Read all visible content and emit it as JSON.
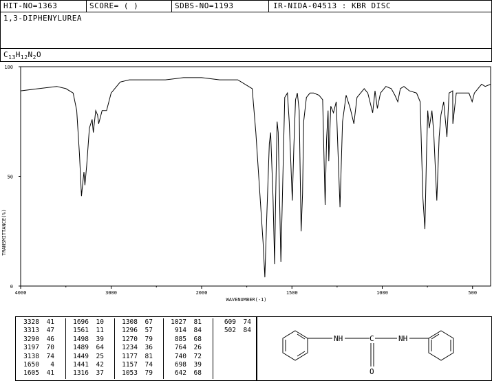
{
  "header": {
    "hit_no": "HIT-NO=1363",
    "score": "SCORE=  (   )",
    "sdbs_no": "SDBS-NO=1193",
    "ir_id": "IR-NIDA-04513 : KBR DISC",
    "compound": "1,3-DIPHENYLUREA",
    "formula": {
      "c": "C",
      "c_n": "13",
      "h": "H",
      "h_n": "12",
      "n": "N",
      "n_n": "2",
      "o": "O"
    }
  },
  "chart_data": {
    "type": "line",
    "title": "",
    "xlabel": "WAVENUMBER(-1)",
    "ylabel": "TRANSMITTANCE(%)",
    "xlim": [
      4000,
      400
    ],
    "ylim": [
      0,
      100
    ],
    "x_ticks": [
      "4000",
      "3000",
      "2000",
      "1500",
      "1000",
      "500"
    ],
    "y_ticks": [
      "100",
      "50",
      "0"
    ],
    "grid": false,
    "series": [
      {
        "points": [
          [
            4000,
            89
          ],
          [
            3800,
            90
          ],
          [
            3600,
            91
          ],
          [
            3500,
            90
          ],
          [
            3420,
            88
          ],
          [
            3380,
            80
          ],
          [
            3350,
            60
          ],
          [
            3328,
            41
          ],
          [
            3313,
            47
          ],
          [
            3300,
            52
          ],
          [
            3290,
            46
          ],
          [
            3270,
            55
          ],
          [
            3240,
            72
          ],
          [
            3210,
            76
          ],
          [
            3197,
            70
          ],
          [
            3170,
            80
          ],
          [
            3150,
            78
          ],
          [
            3138,
            74
          ],
          [
            3100,
            80
          ],
          [
            3050,
            80
          ],
          [
            3000,
            88
          ],
          [
            2900,
            93
          ],
          [
            2800,
            94
          ],
          [
            2600,
            94
          ],
          [
            2400,
            94
          ],
          [
            2200,
            95
          ],
          [
            2000,
            95
          ],
          [
            1900,
            94
          ],
          [
            1800,
            94
          ],
          [
            1720,
            90
          ],
          [
            1700,
            70
          ],
          [
            1660,
            20
          ],
          [
            1650,
            4
          ],
          [
            1640,
            30
          ],
          [
            1625,
            65
          ],
          [
            1618,
            70
          ],
          [
            1605,
            41
          ],
          [
            1596,
            10
          ],
          [
            1590,
            40
          ],
          [
            1582,
            75
          ],
          [
            1576,
            70
          ],
          [
            1561,
            11
          ],
          [
            1550,
            50
          ],
          [
            1540,
            86
          ],
          [
            1525,
            88
          ],
          [
            1515,
            75
          ],
          [
            1498,
            39
          ],
          [
            1489,
            64
          ],
          [
            1480,
            85
          ],
          [
            1470,
            88
          ],
          [
            1460,
            80
          ],
          [
            1449,
            25
          ],
          [
            1441,
            42
          ],
          [
            1435,
            75
          ],
          [
            1420,
            86
          ],
          [
            1400,
            88
          ],
          [
            1380,
            88
          ],
          [
            1350,
            87
          ],
          [
            1330,
            85
          ],
          [
            1316,
            37
          ],
          [
            1308,
            67
          ],
          [
            1300,
            80
          ],
          [
            1296,
            57
          ],
          [
            1285,
            82
          ],
          [
            1270,
            79
          ],
          [
            1255,
            84
          ],
          [
            1234,
            36
          ],
          [
            1220,
            75
          ],
          [
            1200,
            87
          ],
          [
            1177,
            81
          ],
          [
            1157,
            74
          ],
          [
            1140,
            86
          ],
          [
            1100,
            90
          ],
          [
            1080,
            88
          ],
          [
            1053,
            79
          ],
          [
            1040,
            89
          ],
          [
            1027,
            81
          ],
          [
            1010,
            88
          ],
          [
            980,
            91
          ],
          [
            950,
            90
          ],
          [
            930,
            87
          ],
          [
            914,
            84
          ],
          [
            900,
            90
          ],
          [
            880,
            91
          ],
          [
            850,
            89
          ],
          [
            810,
            88
          ],
          [
            790,
            84
          ],
          [
            775,
            40
          ],
          [
            764,
            26
          ],
          [
            755,
            60
          ],
          [
            748,
            80
          ],
          [
            740,
            72
          ],
          [
            725,
            80
          ],
          [
            715,
            70
          ],
          [
            698,
            39
          ],
          [
            685,
            68
          ],
          [
            675,
            78
          ],
          [
            660,
            84
          ],
          [
            642,
            68
          ],
          [
            630,
            88
          ],
          [
            610,
            89
          ],
          [
            609,
            74
          ],
          [
            590,
            88
          ],
          [
            560,
            88
          ],
          [
            520,
            88
          ],
          [
            502,
            84
          ],
          [
            490,
            88
          ],
          [
            470,
            90
          ],
          [
            450,
            92
          ],
          [
            430,
            91
          ],
          [
            400,
            92
          ]
        ]
      }
    ],
    "peak_table": [
      [
        [
          "3328",
          "41"
        ],
        [
          "3313",
          "47"
        ],
        [
          "3290",
          "46"
        ],
        [
          "3197",
          "70"
        ],
        [
          "3138",
          "74"
        ],
        [
          "1650",
          "4"
        ],
        [
          "1605",
          "41"
        ]
      ],
      [
        [
          "1696",
          "10"
        ],
        [
          "1561",
          "11"
        ],
        [
          "1498",
          "39"
        ],
        [
          "1489",
          "64"
        ],
        [
          "1449",
          "25"
        ],
        [
          "1441",
          "42"
        ],
        [
          "1316",
          "37"
        ]
      ],
      [
        [
          "1308",
          "67"
        ],
        [
          "1296",
          "57"
        ],
        [
          "1270",
          "79"
        ],
        [
          "1234",
          "36"
        ],
        [
          "1177",
          "81"
        ],
        [
          "1157",
          "74"
        ],
        [
          "1053",
          "79"
        ]
      ],
      [
        [
          "1027",
          "81"
        ],
        [
          "914",
          "84"
        ],
        [
          "885",
          "68"
        ],
        [
          "764",
          "26"
        ],
        [
          "740",
          "72"
        ],
        [
          "698",
          "39"
        ],
        [
          "642",
          "68"
        ]
      ],
      [
        [
          "609",
          "74"
        ],
        [
          "502",
          "84"
        ]
      ]
    ]
  },
  "structure": {
    "nh_left": "NH",
    "nh_right": "NH",
    "carbon": "C",
    "oxygen": "O"
  }
}
